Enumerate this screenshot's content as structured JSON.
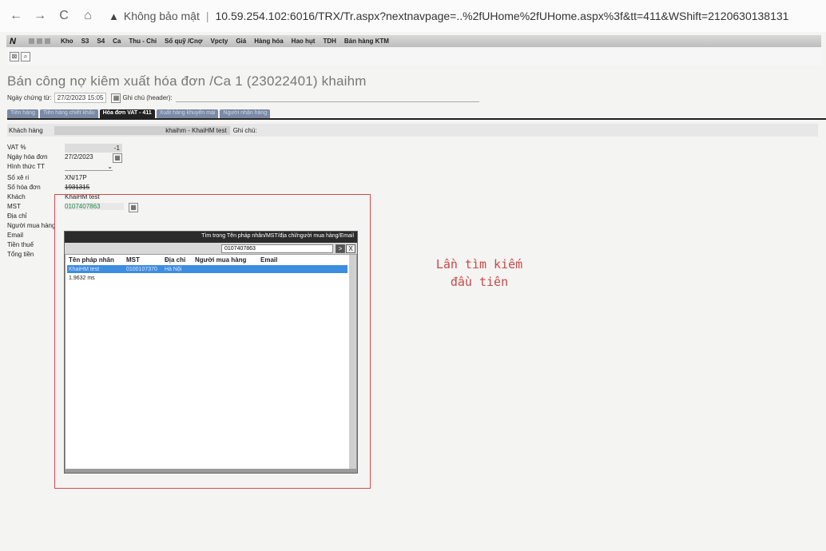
{
  "browser": {
    "back": "←",
    "forward": "→",
    "reload": "C",
    "home": "⌂",
    "security_label": "Không bảo mật",
    "url": "10.59.254.102:6016/TRX/Tr.aspx?nextnavpage=..%2fUHome%2fUHome.aspx%3f&tt=411&WShift=2120630138131"
  },
  "menu": {
    "logo": "N",
    "items": [
      "Kho",
      "S3",
      "S4",
      "Ca",
      "Thu - Chi",
      "Sổ quỹ /Cnợ",
      "Vpcty",
      "Giá",
      "Hàng hóa",
      "Hao hụt",
      "TDH",
      "Bán hàng KTM"
    ]
  },
  "page": {
    "title": "Bán công nợ kiêm xuất hóa đơn /Ca 1 (23022401) khaihm",
    "doc_date_label": "Ngày chứng từ:",
    "doc_date": "27/2/2023 15:05",
    "note_header_label": "Ghi chú (header):"
  },
  "tabs": [
    {
      "label": "Tiền hàng",
      "active": false
    },
    {
      "label": "Tiền hàng chiết khấu",
      "active": false
    },
    {
      "label": "Hóa đơn VAT - 411",
      "active": true
    },
    {
      "label": "Xuất hàng khuyến mại",
      "active": false
    },
    {
      "label": "Người nhận hàng",
      "active": false
    }
  ],
  "customer": {
    "label": "Khách hàng",
    "value": "khaihm - KhaiHM test",
    "note_label": "Ghi chú:"
  },
  "form": {
    "vat_label": "VAT %",
    "vat_value": "-1",
    "invoice_date_label": "Ngày hóa đơn",
    "invoice_date": "27/2/2023",
    "payment_label": "Hình thức TT",
    "plate_label": "Số xê ri",
    "plate_value": "XN/17P",
    "invoice_no_label": "Số hóa đơn",
    "invoice_no_value": "1931315",
    "customer_label": "Khách",
    "customer_value": "KhaiHM test",
    "tax_label": "MST",
    "tax_value": "0107407863",
    "address_label": "Địa chỉ",
    "buyer_label": "Người mua hàng",
    "email_label": "Email",
    "tax_money_label": "Tiền thuế",
    "total_label": "Tổng tiền"
  },
  "popup": {
    "header": "Tìm trong Tên pháp nhân/MST/địa chỉ/người mua hàng/Email",
    "search_value": "0107407863",
    "go": ">",
    "close": "X",
    "columns": [
      "Tên pháp nhân",
      "MST",
      "Địa chỉ",
      "Người mua hàng",
      "Email"
    ],
    "rows": [
      [
        "KhaiHM test",
        "0100107370",
        "Hà Nội",
        "",
        ""
      ]
    ],
    "timing": "1.9632 ms"
  },
  "annotation": {
    "line1": "Lần tìm kiếm",
    "line2": "đầu tiên",
    "color": "#d64a4a"
  }
}
